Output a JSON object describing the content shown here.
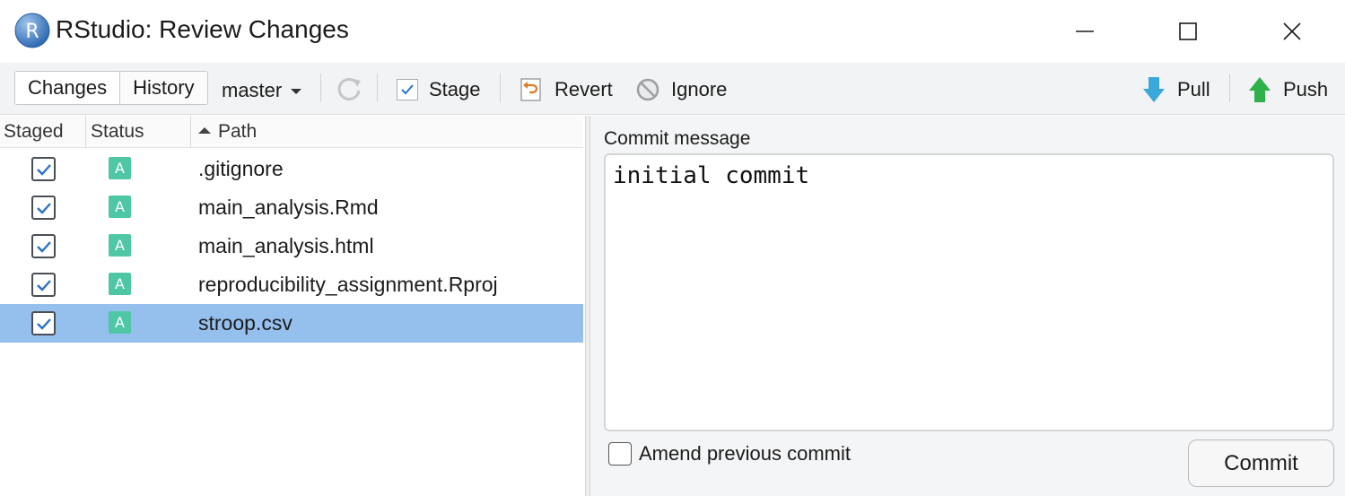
{
  "window": {
    "title": "RStudio: Review Changes",
    "logo_letter": "R"
  },
  "toolbar": {
    "tabs": [
      {
        "label": "Changes",
        "active": true
      },
      {
        "label": "History",
        "active": false
      }
    ],
    "branch": "master",
    "stage_label": "Stage",
    "revert_label": "Revert",
    "ignore_label": "Ignore",
    "pull_label": "Pull",
    "push_label": "Push"
  },
  "files_table": {
    "columns": [
      "Staged",
      "Status",
      "Path"
    ],
    "sort_column": "Path",
    "rows": [
      {
        "staged": true,
        "status": "A",
        "path": ".gitignore",
        "selected": false
      },
      {
        "staged": true,
        "status": "A",
        "path": "main_analysis.Rmd",
        "selected": false
      },
      {
        "staged": true,
        "status": "A",
        "path": "main_analysis.html",
        "selected": false
      },
      {
        "staged": true,
        "status": "A",
        "path": "reproducibility_assignment.Rproj",
        "selected": false
      },
      {
        "staged": true,
        "status": "A",
        "path": "stroop.csv",
        "selected": true
      }
    ]
  },
  "commit": {
    "label": "Commit message",
    "message": "initial commit",
    "amend_label": "Amend previous commit",
    "amend_checked": false,
    "button_label": "Commit"
  },
  "colors": {
    "selection": "#95c0ee",
    "added_badge": "#4fc7a4",
    "pull_arrow": "#3aa8d8",
    "push_arrow": "#2db24a",
    "revert_arrow": "#e07a1f"
  }
}
